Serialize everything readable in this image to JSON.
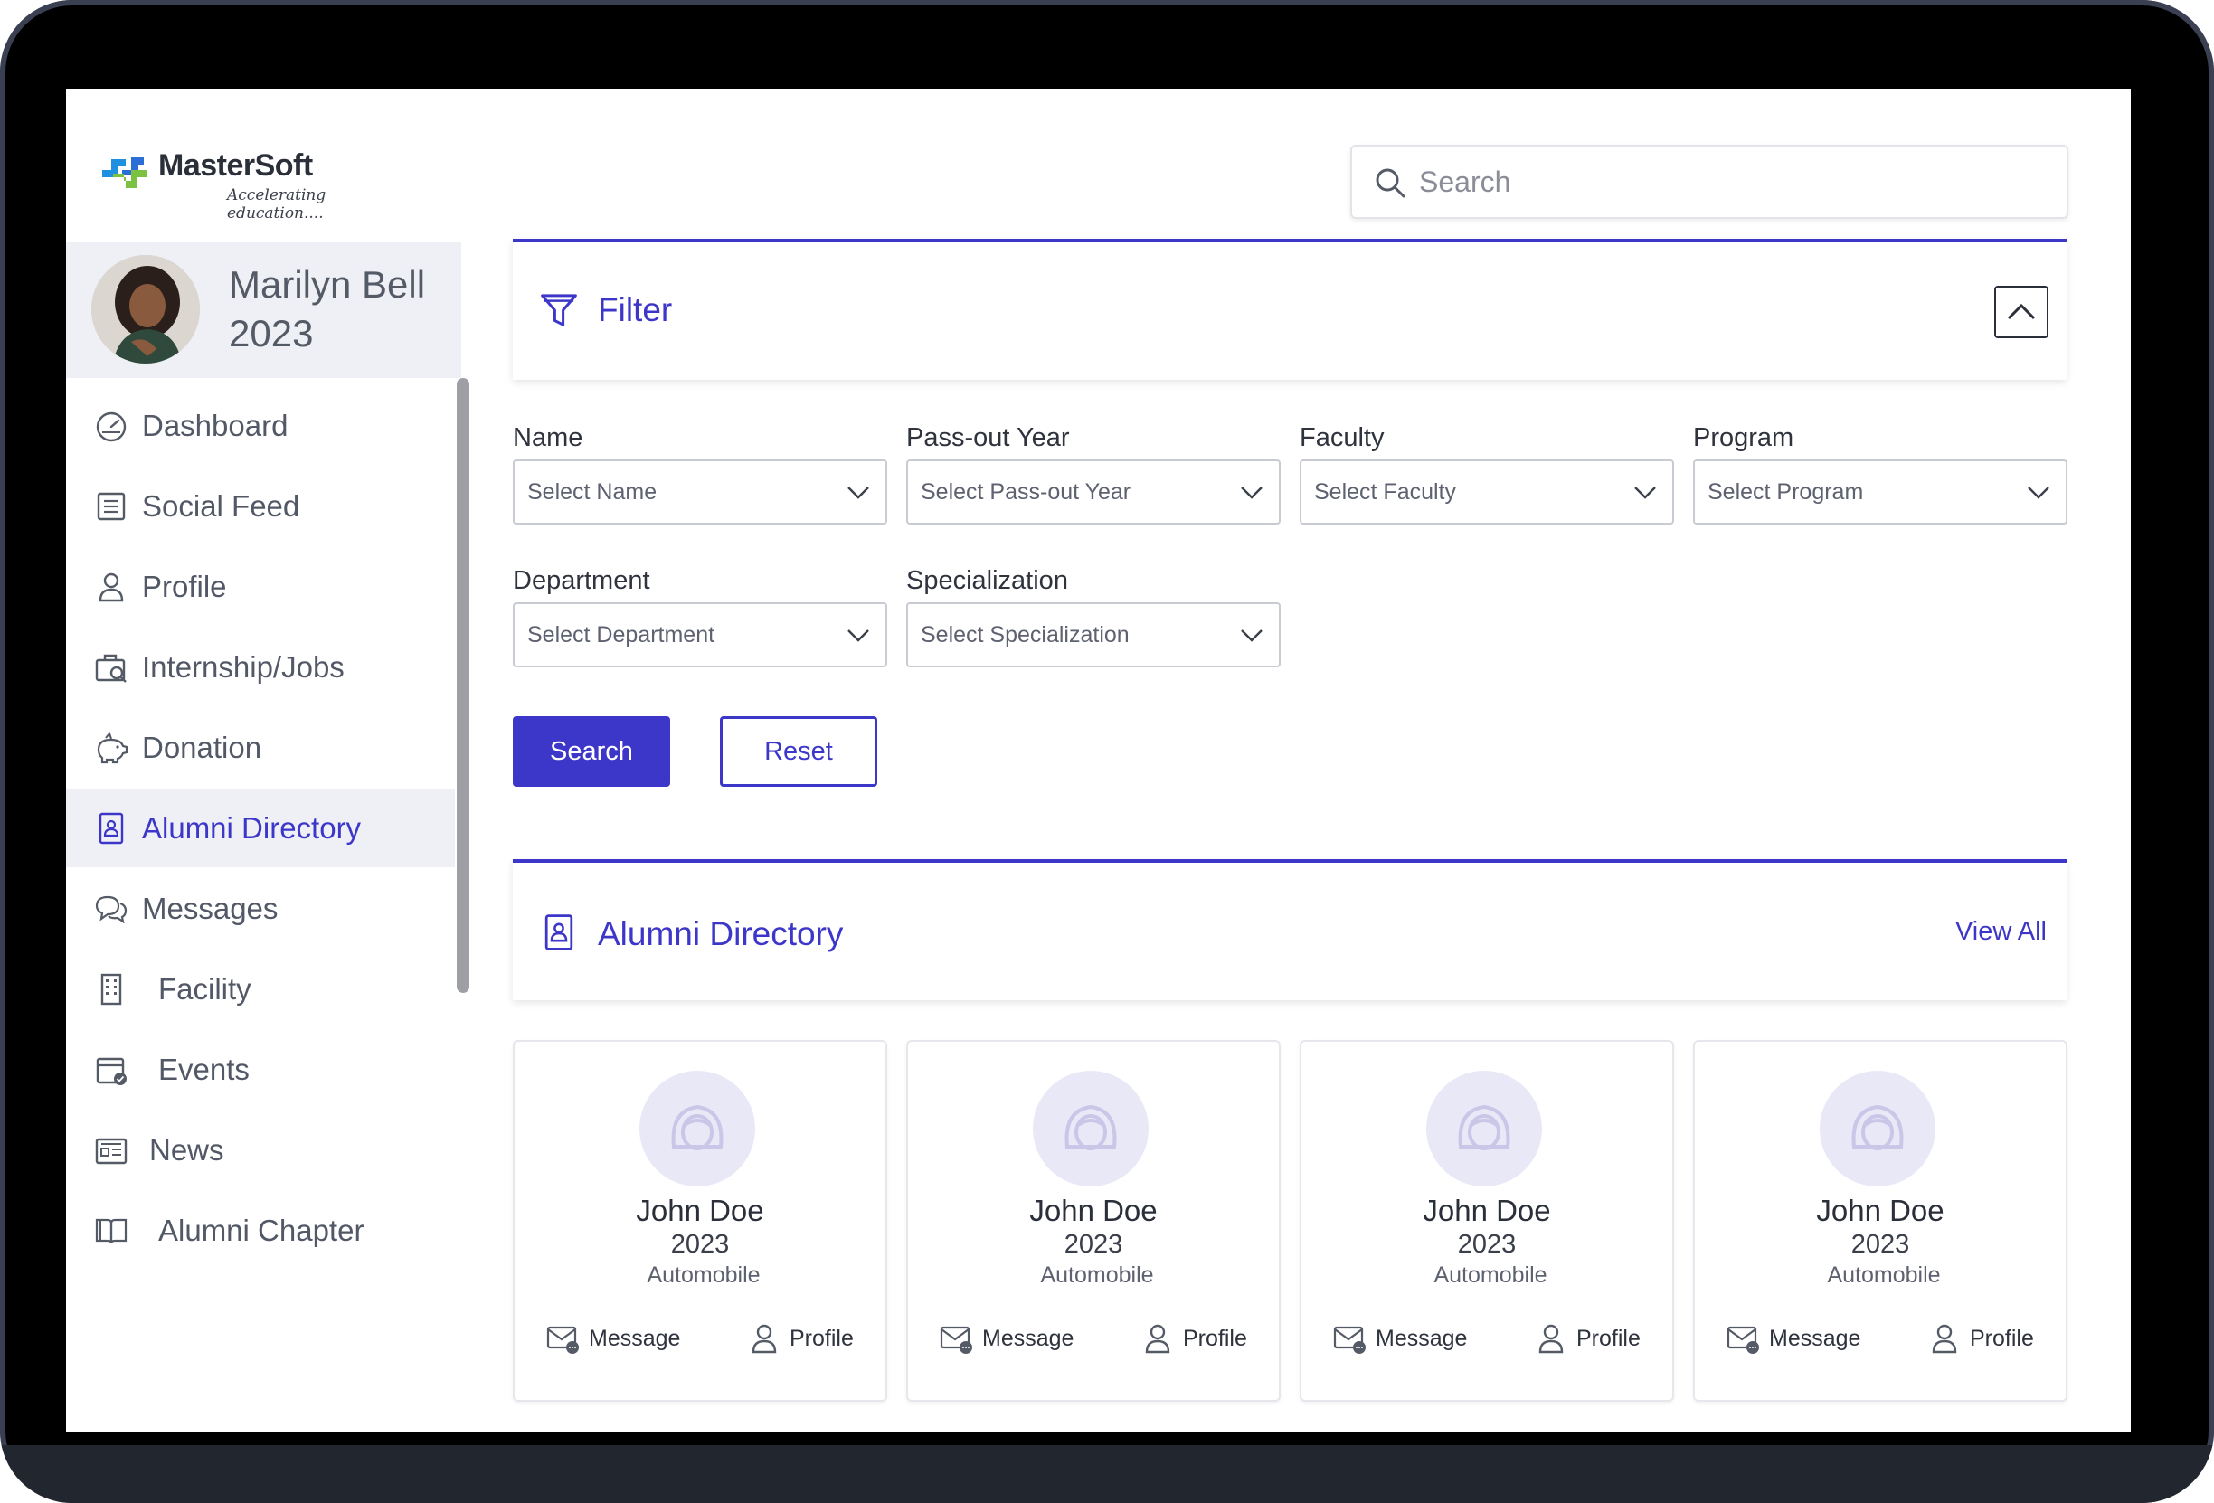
{
  "brand": {
    "name": "MasterSoft",
    "tagline": "Accelerating education....",
    "colors": {
      "primary": "#3d37c9",
      "logo_blue": "#1f8fe0",
      "logo_green": "#7cc242"
    }
  },
  "header": {
    "search_placeholder": "Search"
  },
  "user": {
    "name": "Marilyn Bell",
    "year": "2023"
  },
  "sidebar": {
    "items": [
      {
        "label": "Dashboard",
        "icon": "dashboard-icon"
      },
      {
        "label": "Social Feed",
        "icon": "feed-icon"
      },
      {
        "label": "Profile",
        "icon": "user-icon"
      },
      {
        "label": "Internship/Jobs",
        "icon": "briefcase-search-icon"
      },
      {
        "label": "Donation",
        "icon": "piggy-bank-icon"
      },
      {
        "label": "Alumni Directory",
        "icon": "directory-icon",
        "active": true
      },
      {
        "label": "Messages",
        "icon": "chat-icon"
      },
      {
        "label": "Facility",
        "icon": "building-icon"
      },
      {
        "label": "Events",
        "icon": "calendar-check-icon"
      },
      {
        "label": "News",
        "icon": "newspaper-icon"
      },
      {
        "label": "Alumni Chapter",
        "icon": "book-icon"
      }
    ]
  },
  "filter": {
    "title": "Filter",
    "fields": [
      {
        "label": "Name",
        "placeholder": "Select Name"
      },
      {
        "label": "Pass-out Year",
        "placeholder": "Select Pass-out Year"
      },
      {
        "label": "Faculty",
        "placeholder": "Select Faculty"
      },
      {
        "label": "Program",
        "placeholder": "Select Program"
      },
      {
        "label": "Department",
        "placeholder": "Select Department"
      },
      {
        "label": "Specialization",
        "placeholder": "Select Specialization"
      }
    ],
    "search_label": "Search",
    "reset_label": "Reset"
  },
  "directory": {
    "title": "Alumni Directory",
    "view_all": "View All",
    "cards": [
      {
        "name": "John Doe",
        "year": "2023",
        "department": "Automobile",
        "message_label": "Message",
        "profile_label": "Profile"
      },
      {
        "name": "John Doe",
        "year": "2023",
        "department": "Automobile",
        "message_label": "Message",
        "profile_label": "Profile"
      },
      {
        "name": "John Doe",
        "year": "2023",
        "department": "Automobile",
        "message_label": "Message",
        "profile_label": "Profile"
      },
      {
        "name": "John Doe",
        "year": "2023",
        "department": "Automobile",
        "message_label": "Message",
        "profile_label": "Profile"
      }
    ]
  }
}
